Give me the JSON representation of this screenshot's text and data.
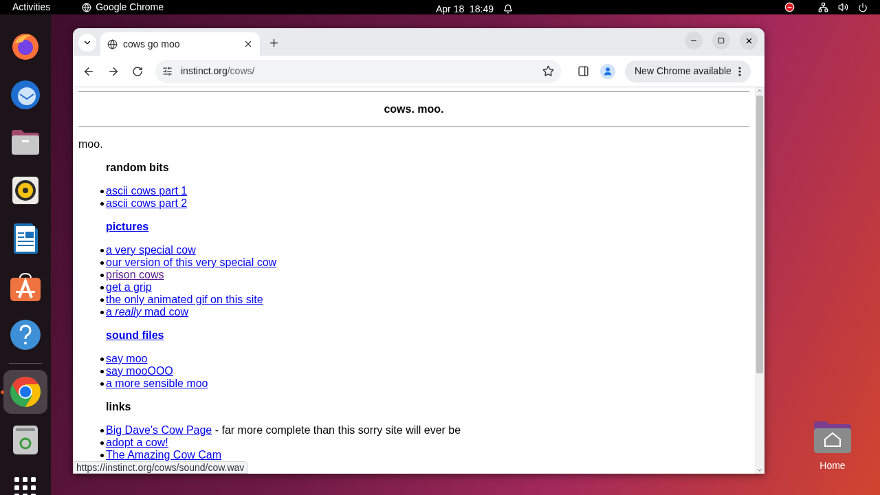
{
  "topbar": {
    "activities": "Activities",
    "app": "Google Chrome",
    "clock": "Apr 18  18:49"
  },
  "dock": {
    "items": [
      {
        "kind": "firefox",
        "running": false
      },
      {
        "kind": "mail",
        "running": false
      },
      {
        "kind": "files",
        "running": false
      },
      {
        "kind": "music",
        "running": false
      },
      {
        "kind": "writer",
        "running": false
      },
      {
        "kind": "store",
        "running": false
      },
      {
        "kind": "help",
        "running": false
      },
      {
        "kind": "separator"
      },
      {
        "kind": "chrome",
        "running": true
      },
      {
        "kind": "trash",
        "running": false
      },
      {
        "kind": "grid",
        "running": false
      }
    ]
  },
  "desktop_icons": [
    {
      "label": "Home"
    }
  ],
  "browser": {
    "tabs": [
      {
        "title": "cows go moo",
        "selected": true
      }
    ],
    "address": {
      "host": "instinct.org",
      "path": "/cows/"
    },
    "update_button": "New Chrome available",
    "status_url": "https://instinct.org/cows/sound/cow.wav",
    "page": {
      "title": "cows. moo.",
      "intro": "moo.",
      "sections": [
        {
          "heading": "random bits",
          "heading_link": false,
          "items": [
            {
              "text": "ascii cows part 1",
              "visited": false
            },
            {
              "text": "ascii cows part 2",
              "visited": false
            }
          ]
        },
        {
          "heading": "pictures",
          "heading_link": true,
          "items": [
            {
              "text": "a very special cow",
              "visited": false
            },
            {
              "text": "our version of this very special cow",
              "visited": false
            },
            {
              "text": "prison cows",
              "visited": true
            },
            {
              "text": "get a grip",
              "visited": false
            },
            {
              "text": "the only animated gif on this site",
              "visited": false
            },
            {
              "text": "a *really* mad cow",
              "visited": false
            }
          ]
        },
        {
          "heading": "sound files",
          "heading_link": true,
          "items": [
            {
              "text": "say moo",
              "visited": false
            },
            {
              "text": "say mooOOO",
              "visited": false
            },
            {
              "text": "a more sensible moo",
              "visited": false
            }
          ]
        },
        {
          "heading": "links",
          "heading_link": false,
          "items": [
            {
              "text": "Big Dave's Cow Page",
              "visited": false,
              "note": " - far more complete than this sorry site will ever be"
            },
            {
              "text": "adopt a cow!",
              "visited": false
            },
            {
              "text": "The Amazing Cow Cam",
              "visited": false
            }
          ]
        }
      ]
    }
  }
}
